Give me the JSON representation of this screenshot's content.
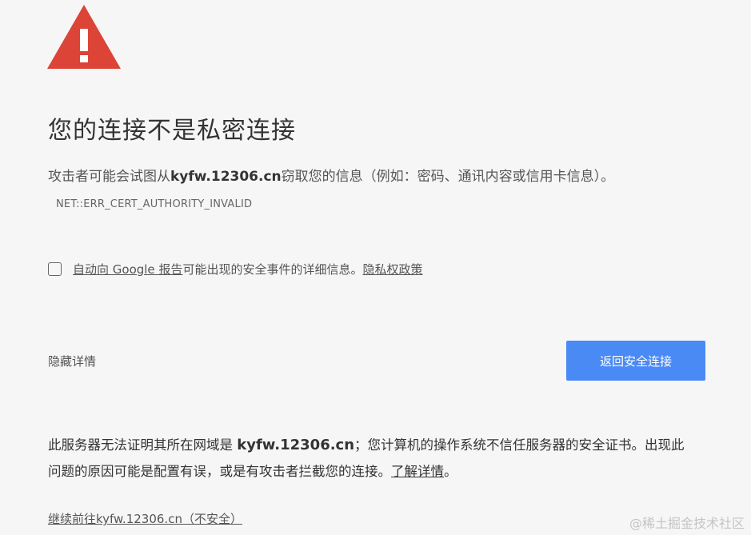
{
  "title": "您的连接不是私密连接",
  "message": {
    "prefix": "攻击者可能会试图从",
    "domain": "kyfw.12306.cn",
    "suffix": "窃取您的信息（例如：密码、通讯内容或信用卡信息）。",
    "error_code": "NET::ERR_CERT_AUTHORITY_INVALID"
  },
  "report": {
    "link_label": "自动向 Google 报告",
    "text": "可能出现的安全事件的详细信息。",
    "privacy_label": "隐私权政策"
  },
  "hide_details_label": "隐藏详情",
  "back_button_label": "返回安全连接",
  "details": {
    "prefix": "此服务器无法证明其所在网域是 ",
    "domain": "kyfw.12306.cn",
    "middle": "；您计算机的操作系统不信任服务器的安全证书。出现此问题的原因可能是配置有误，或是有攻击者拦截您的连接。",
    "learn_more_label": "了解详情",
    "end": "。"
  },
  "proceed_link": "继续前往kyfw.12306.cn（不安全）",
  "watermark": "@稀土掘金技术社区",
  "icon": "warning-triangle-icon",
  "colors": {
    "warning_red": "#db4437",
    "button_blue": "#4a8af4",
    "background": "#f6f6f6"
  }
}
